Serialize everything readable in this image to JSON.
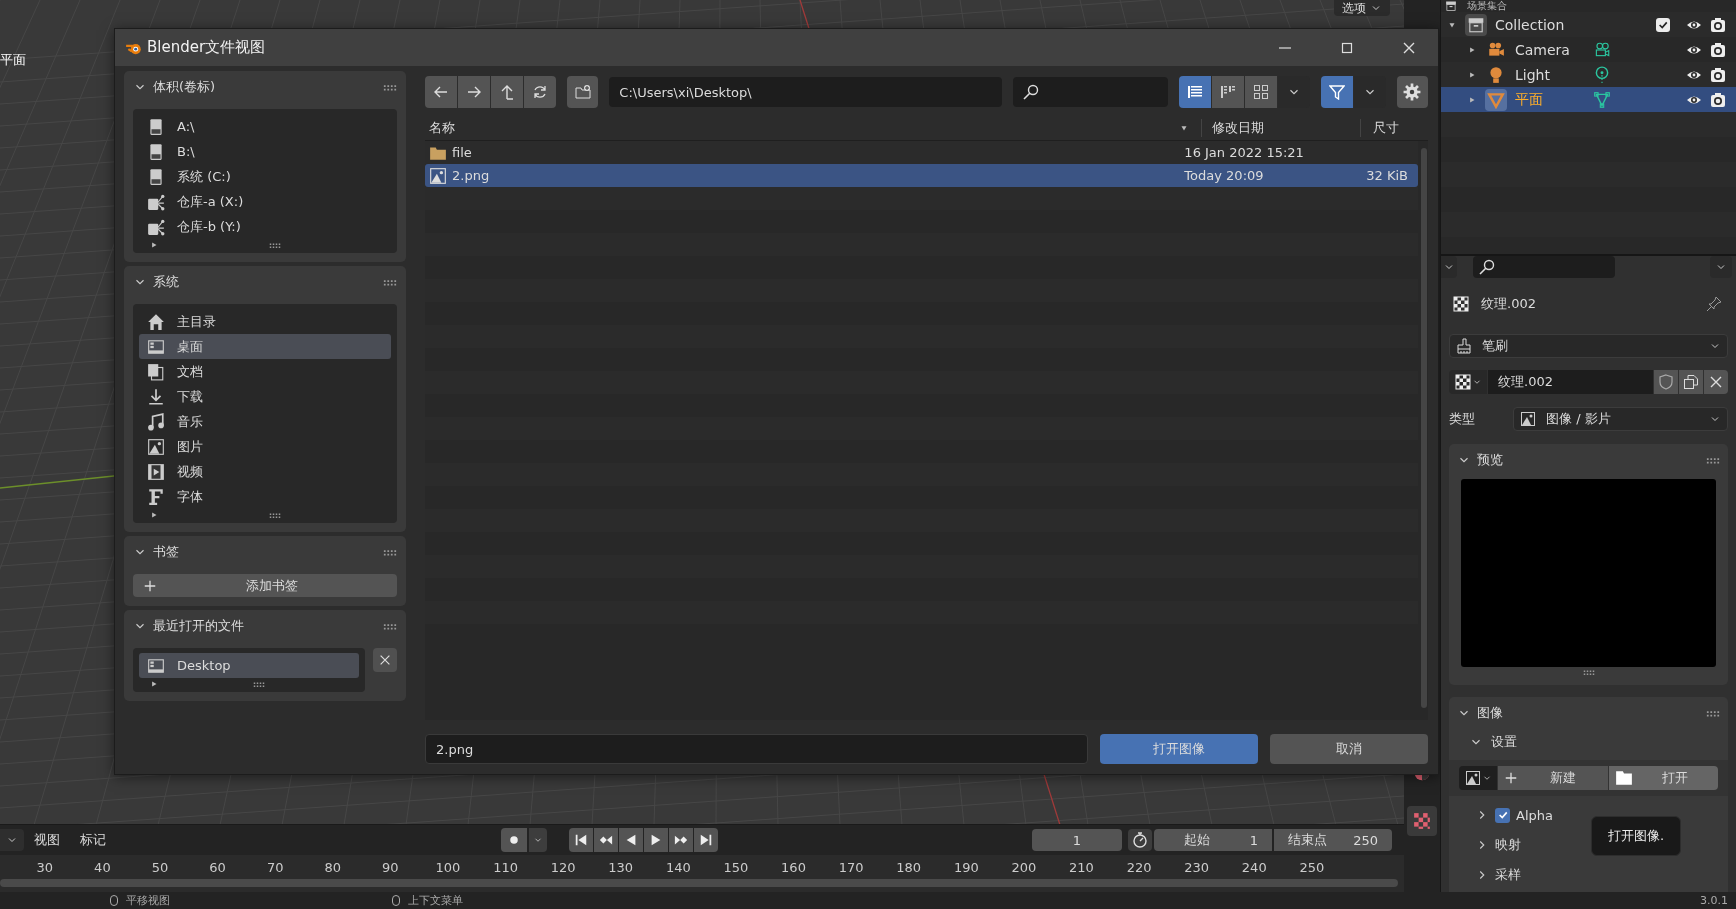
{
  "viewport": {
    "object_label": "平面",
    "header_option": "选项"
  },
  "dialog": {
    "title": "Blender文件视图",
    "sidebar": [
      {
        "title": "体积(卷标)",
        "kind": "list",
        "expanded": true,
        "items": [
          {
            "label": "A:\\",
            "kind": "drive",
            "selected": false
          },
          {
            "label": "B:\\",
            "kind": "drive",
            "selected": false
          },
          {
            "label": "系统 (C:)",
            "kind": "drive",
            "selected": false
          },
          {
            "label": "仓库-a (X:)",
            "kind": "network",
            "selected": false
          },
          {
            "label": "仓库-b (Y:)",
            "kind": "network",
            "selected": false
          }
        ]
      },
      {
        "title": "系统",
        "kind": "list",
        "expanded": true,
        "items": [
          {
            "label": "主目录",
            "kind": "home",
            "selected": false
          },
          {
            "label": "桌面",
            "kind": "desktop",
            "selected": true
          },
          {
            "label": "文档",
            "kind": "documents",
            "selected": false
          },
          {
            "label": "下载",
            "kind": "download",
            "selected": false
          },
          {
            "label": "音乐",
            "kind": "music",
            "selected": false
          },
          {
            "label": "图片",
            "kind": "picture",
            "selected": false
          },
          {
            "label": "视频",
            "kind": "film",
            "selected": false
          },
          {
            "label": "字体",
            "kind": "font",
            "selected": false
          }
        ]
      },
      {
        "title": "书签",
        "kind": "button",
        "expanded": true,
        "button": "添加书签"
      },
      {
        "title": "最近打开的文件",
        "kind": "recent",
        "expanded": true,
        "items": [
          {
            "label": "Desktop",
            "kind": "desktop",
            "selected": true
          }
        ]
      }
    ],
    "path": "C:\\Users\\xi\\Desktop\\",
    "view_modes": [
      {
        "kind": "vertical",
        "selected": true
      },
      {
        "kind": "horizontal",
        "selected": false
      },
      {
        "kind": "thumbnails",
        "selected": false
      }
    ],
    "filter": {
      "on": true
    },
    "columns": [
      "名称",
      "修改日期",
      "尺寸"
    ],
    "files": [
      {
        "name": "file",
        "kind": "folder",
        "date": "16 Jan 2022 15:21",
        "selected": false
      },
      {
        "name": "2.png",
        "kind": "image",
        "date": "Today 20:09",
        "size": "32 KiB",
        "selected": true
      }
    ],
    "filename": "2.png",
    "buttons": [
      {
        "label": "打开图像",
        "kind": "primary"
      },
      {
        "label": "取消",
        "kind": "secondary"
      }
    ]
  },
  "outliner": {
    "header": "场景集合",
    "items": [
      {
        "name": "Collection",
        "kind": "collection",
        "expanded": true,
        "checked": true,
        "selected": false,
        "children": [
          {
            "name": "Camera",
            "kind": "camera",
            "expanded": false,
            "selected": false
          },
          {
            "name": "Light",
            "kind": "light",
            "expanded": false,
            "selected": false
          },
          {
            "name": "平面",
            "kind": "mesh",
            "expanded": false,
            "selected": true
          }
        ]
      }
    ]
  },
  "properties": {
    "texture_name": "纹理.002",
    "context": "笔刷",
    "texture_field": "纹理.002",
    "type_label": "类型",
    "type_value": "图像 / 影片",
    "preview": {
      "title": "预览",
      "expanded": true
    },
    "image_panel": {
      "title": "图像",
      "expanded": true,
      "subpanel": "设置",
      "new_button": "新建",
      "open_button": "打开",
      "options": [
        {
          "label": "Alpha",
          "kind": "checkbox",
          "checked": true
        },
        {
          "label": "映射",
          "kind": "subpanel"
        },
        {
          "label": "采样",
          "kind": "subpanel"
        }
      ]
    },
    "tooltip": "打开图像."
  },
  "timeline": {
    "menus": [
      "视图",
      "标记"
    ],
    "current_frame": "1",
    "start_label": "起始",
    "start": "1",
    "end_label": "结束点",
    "end": "250",
    "ticks": [
      "30",
      "40",
      "50",
      "60",
      "70",
      "80",
      "90",
      "100",
      "110",
      "120",
      "130",
      "140",
      "150",
      "160",
      "170",
      "180",
      "190",
      "200",
      "210",
      "220",
      "230",
      "240",
      "250"
    ]
  },
  "status_bar": {
    "items": [
      "平移视图",
      "上下文菜单"
    ],
    "version": "3.0.1"
  }
}
